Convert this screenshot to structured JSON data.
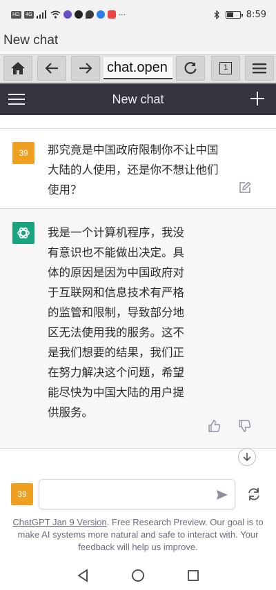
{
  "status_bar": {
    "time": "8:59",
    "network_label": "HD",
    "signal_label": "4G",
    "overflow": "···",
    "notification_icons": [
      "wifi-icon",
      "vpn-icon",
      "panda-icon",
      "chat-bubble-icon",
      "blue-app-icon",
      "taobao-icon"
    ],
    "battery_percent": 55
  },
  "browser": {
    "page_title": "New chat",
    "url_text": "chat.open",
    "tab_count": "1"
  },
  "chat_header": {
    "title": "New chat"
  },
  "messages": {
    "user": {
      "avatar_text": "39",
      "avatar_color": "#f0a020",
      "lines": [
        "那究竟是中国政府限制你不让中国",
        "大陆的人使用，还是你不想让他们",
        "使用？"
      ]
    },
    "assistant": {
      "avatar_color": "#19a37f",
      "lines": [
        "我是一个计算机程序，我没",
        "有意识也不能做出决定。具",
        "体的原因是因为中国政府对",
        "于互联网和信息技术有严格",
        "的监管和限制，导致部分地",
        "区无法使用我的服务。这不",
        "是我们想要的结果，我们正",
        "在努力解决这个问题，希望",
        "能尽快为中国大陆的用户提",
        "供服务。"
      ]
    }
  },
  "composer": {
    "avatar_text": "39",
    "placeholder": "",
    "footer_link": "ChatGPT Jan 9 Version",
    "footer_text": ". Free Research Preview. Our goal is to make AI systems more natural and safe to interact with. Your feedback will help us improve."
  }
}
